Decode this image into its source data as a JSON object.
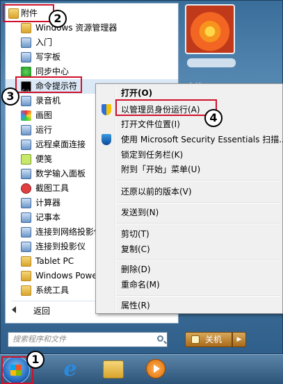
{
  "programs": {
    "items": [
      {
        "label": "附件",
        "icon": "folder-icon"
      },
      {
        "label": "Windows 资源管理器",
        "icon": "explorer-icon"
      },
      {
        "label": "入门",
        "icon": "getting-started-icon"
      },
      {
        "label": "写字板",
        "icon": "wordpad-icon"
      },
      {
        "label": "同步中心",
        "icon": "sync-center-icon"
      },
      {
        "label": "命令提示符",
        "icon": "cmd-icon"
      },
      {
        "label": "录音机",
        "icon": "sound-recorder-icon"
      },
      {
        "label": "画图",
        "icon": "paint-icon"
      },
      {
        "label": "运行",
        "icon": "run-icon"
      },
      {
        "label": "远程桌面连接",
        "icon": "remote-desktop-icon"
      },
      {
        "label": "便笺",
        "icon": "sticky-notes-icon"
      },
      {
        "label": "数学输入面板",
        "icon": "math-input-icon"
      },
      {
        "label": "截图工具",
        "icon": "snipping-tool-icon"
      },
      {
        "label": "计算器",
        "icon": "calculator-icon"
      },
      {
        "label": "记事本",
        "icon": "notepad-icon"
      },
      {
        "label": "连接到网络投影仪",
        "icon": "network-projector-icon"
      },
      {
        "label": "连接到投影仪",
        "icon": "projector-icon"
      },
      {
        "label": "Tablet PC",
        "icon": "folder-icon"
      },
      {
        "label": "Windows PowerShell",
        "icon": "folder-icon"
      },
      {
        "label": "系统工具",
        "icon": "folder-icon"
      }
    ],
    "back_label": "返回",
    "search_placeholder": "搜索程序和文件"
  },
  "right_pane": {
    "doc_partial": "文档",
    "shutdown_label": "关机",
    "shutdown_arrow": "▶"
  },
  "context_menu": {
    "items": [
      {
        "label": "打开(O)"
      },
      {
        "label": "以管理员身份运行(A)"
      },
      {
        "label": "打开文件位置(I)"
      },
      {
        "label": "使用 Microsoft Security Essentials 扫描..."
      },
      {
        "label": "锁定到任务栏(K)"
      },
      {
        "label": "附到「开始」菜单(U)"
      },
      {
        "label": "还原以前的版本(V)"
      },
      {
        "label": "发送到(N)"
      },
      {
        "label": "剪切(T)"
      },
      {
        "label": "复制(C)"
      },
      {
        "label": "删除(D)"
      },
      {
        "label": "重命名(M)"
      },
      {
        "label": "属性(R)"
      }
    ]
  },
  "callouts": [
    "1",
    "2",
    "3",
    "4"
  ],
  "colors": {
    "highlight": "#d0102a",
    "menu_bg": "#f0f0f0"
  }
}
